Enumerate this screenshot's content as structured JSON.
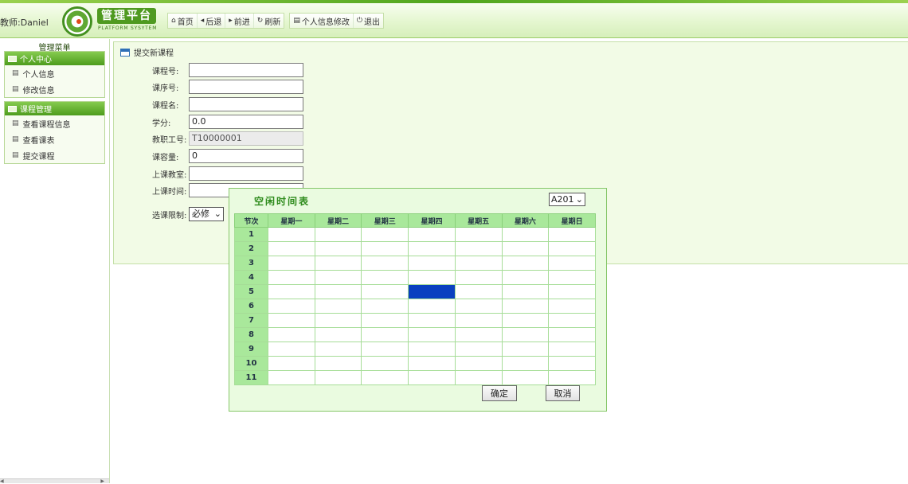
{
  "header": {
    "user_label": "教师:Daniel",
    "logo_title": "管理平台",
    "logo_subtitle": "PLATFORM SYSYTEM",
    "toolbar": [
      {
        "icon": "home-icon",
        "glyph": "⌂",
        "label": "首页"
      },
      {
        "icon": "back-icon",
        "glyph": "◂",
        "label": "后退"
      },
      {
        "icon": "forward-icon",
        "glyph": "▸",
        "label": "前进"
      },
      {
        "icon": "refresh-icon",
        "glyph": "↻",
        "label": "刷新"
      },
      {
        "icon": "profile-icon",
        "glyph": "▤",
        "label": "个人信息修改"
      },
      {
        "icon": "power-icon",
        "glyph": "⏻",
        "label": "退出"
      }
    ]
  },
  "sidebar": {
    "title": "管理菜单",
    "groups": [
      {
        "label": "个人中心",
        "items": [
          "个人信息",
          "修改信息"
        ]
      },
      {
        "label": "课程管理",
        "items": [
          "查看课程信息",
          "查看课表",
          "提交课程"
        ]
      }
    ]
  },
  "main": {
    "title": "提交新课程",
    "fields": {
      "course_no": {
        "label": "课程号:",
        "value": ""
      },
      "seq_no": {
        "label": "课序号:",
        "value": ""
      },
      "course_name": {
        "label": "课程名:",
        "value": ""
      },
      "credit": {
        "label": "学分:",
        "value": "0.0"
      },
      "teacher_id": {
        "label": "教职工号:",
        "value": "T10000001"
      },
      "capacity": {
        "label": "课容量:",
        "value": "0"
      },
      "classroom": {
        "label": "上课教室:",
        "value": ""
      },
      "class_time": {
        "label": "上课时间:",
        "value": ""
      },
      "restriction": {
        "label": "选课限制:",
        "value": "必修"
      }
    }
  },
  "popup": {
    "title": "空闲时间表",
    "room": "A201",
    "columns": [
      "节次",
      "星期一",
      "星期二",
      "星期三",
      "星期四",
      "星期五",
      "星期六",
      "星期日"
    ],
    "periods": [
      "1",
      "2",
      "3",
      "4",
      "5",
      "6",
      "7",
      "8",
      "9",
      "10",
      "11"
    ],
    "selected": {
      "period": "5",
      "day": "星期四"
    },
    "selected_color": "#0a40c0",
    "ok_label": "确定",
    "cancel_label": "取消"
  },
  "colors": {
    "accent": "#4d9c1d",
    "panel_bg": "#f2fbe6",
    "header_green": "#a9e89b"
  }
}
